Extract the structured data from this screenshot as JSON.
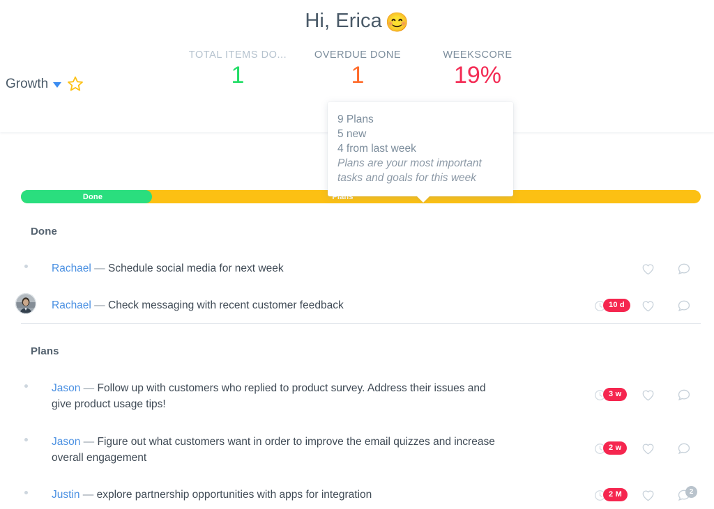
{
  "header": {
    "greeting": "Hi, Erica",
    "greeting_emoji": "😊",
    "growth": {
      "label": "Growth",
      "caret_icon": "chevron-down-icon",
      "star_icon": "star-outline-icon"
    },
    "stats": [
      {
        "label": "TOTAL ITEMS DO...",
        "value": "1",
        "color": "#22dd66",
        "tone": "muted"
      },
      {
        "label": "OVERDUE DONE",
        "value": "1",
        "color": "#ff6b2b",
        "tone": "dark"
      },
      {
        "label": "WEEKSCORE",
        "value": "19%",
        "color": "#f32b54",
        "tone": "dark"
      }
    ]
  },
  "tooltip": {
    "count_line": "9 Plans",
    "new_line": "5 new",
    "last_week_line": "4 from last week",
    "note": "Plans are your most important tasks and goals for this week"
  },
  "progress": {
    "done_label": "Done",
    "plans_label": "Plans",
    "done_color": "#2ade7e",
    "plans_color": "#fcc013"
  },
  "sections": [
    {
      "title": "Done",
      "rows": [
        {
          "marker": "dot",
          "assignee": "Rachael",
          "separator": " — ",
          "text": "Schedule social media for next week",
          "time_badge": null,
          "heart_icon": "heart-outline-icon",
          "comment_icon": "comment-bubble-icon",
          "comment_count": null
        },
        {
          "marker": "avatar",
          "assignee": "Rachael",
          "separator": " — ",
          "text": "Check messaging with recent customer feedback",
          "time_badge": "10 d",
          "heart_icon": "heart-outline-icon",
          "comment_icon": "comment-bubble-icon",
          "comment_count": null
        }
      ]
    },
    {
      "title": "Plans",
      "rows": [
        {
          "marker": "dot",
          "assignee": "Jason",
          "separator": " — ",
          "text": "Follow up with customers who replied to product survey. Address their issues and give product usage tips!",
          "time_badge": "3 w",
          "heart_icon": "heart-outline-icon",
          "comment_icon": "comment-bubble-icon",
          "comment_count": null
        },
        {
          "marker": "dot",
          "assignee": "Jason",
          "separator": " — ",
          "text": "Figure out what customers want in order to improve the email quizzes and increase overall engagement",
          "time_badge": "2 w",
          "heart_icon": "heart-outline-icon",
          "comment_icon": "comment-bubble-icon",
          "comment_count": null
        },
        {
          "marker": "dot",
          "assignee": "Justin",
          "separator": " — ",
          "text": "explore partnership opportunities with apps for integration",
          "time_badge": "2 M",
          "heart_icon": "heart-outline-icon",
          "comment_icon": "comment-bubble-icon",
          "comment_count": "2"
        }
      ]
    }
  ]
}
